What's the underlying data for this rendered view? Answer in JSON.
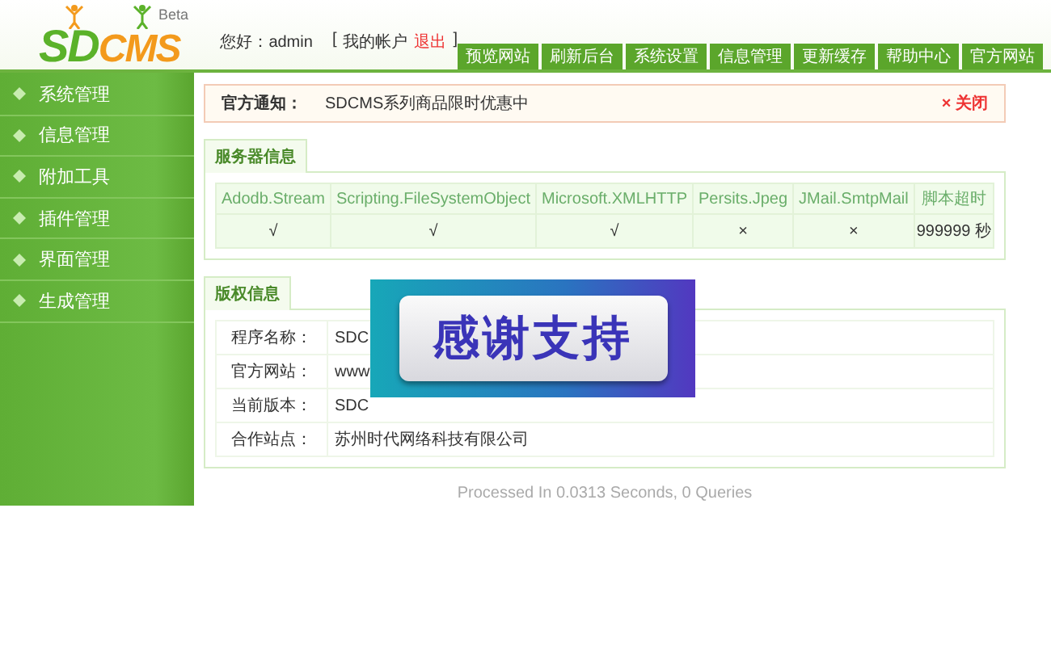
{
  "logo": {
    "part_1": "SD",
    "part_2": "CMS",
    "badge": "Beta"
  },
  "header": {
    "greeting": "您好：admin",
    "bracket_open": "[",
    "account_link": "我的帐户",
    "logout_link": "退出",
    "bracket_close": "]"
  },
  "top_nav": [
    "预览网站",
    "刷新后台",
    "系统设置",
    "信息管理",
    "更新缓存",
    "帮助中心",
    "官方网站"
  ],
  "sidebar": {
    "items": [
      "系统管理",
      "信息管理",
      "附加工具",
      "插件管理",
      "界面管理",
      "生成管理"
    ]
  },
  "notice": {
    "label": "官方通知：",
    "text": "SDCMS系列商品限时优惠中",
    "close_mark": "×",
    "close_label": "关闭"
  },
  "server_info": {
    "tab": "服务器信息",
    "columns": [
      "Adodb.Stream",
      "Scripting.FileSystemObject",
      "Microsoft.XMLHTTP",
      "Persits.Jpeg",
      "JMail.SmtpMail",
      "脚本超时"
    ],
    "rows": [
      [
        "√",
        "√",
        "√",
        "×",
        "×",
        "999999 秒"
      ]
    ]
  },
  "copyright": {
    "tab": "版权信息",
    "rows": [
      {
        "label": "程序名称：",
        "value": "SDC"
      },
      {
        "label": "官方网站：",
        "value": "www"
      },
      {
        "label": "当前版本：",
        "value": "SDC"
      },
      {
        "label": "合作站点：",
        "value": "苏州时代网络科技有限公司"
      }
    ]
  },
  "overlay_banner": {
    "text": "感谢支持"
  },
  "footer": "Processed In 0.0313 Seconds, 0 Queries"
}
